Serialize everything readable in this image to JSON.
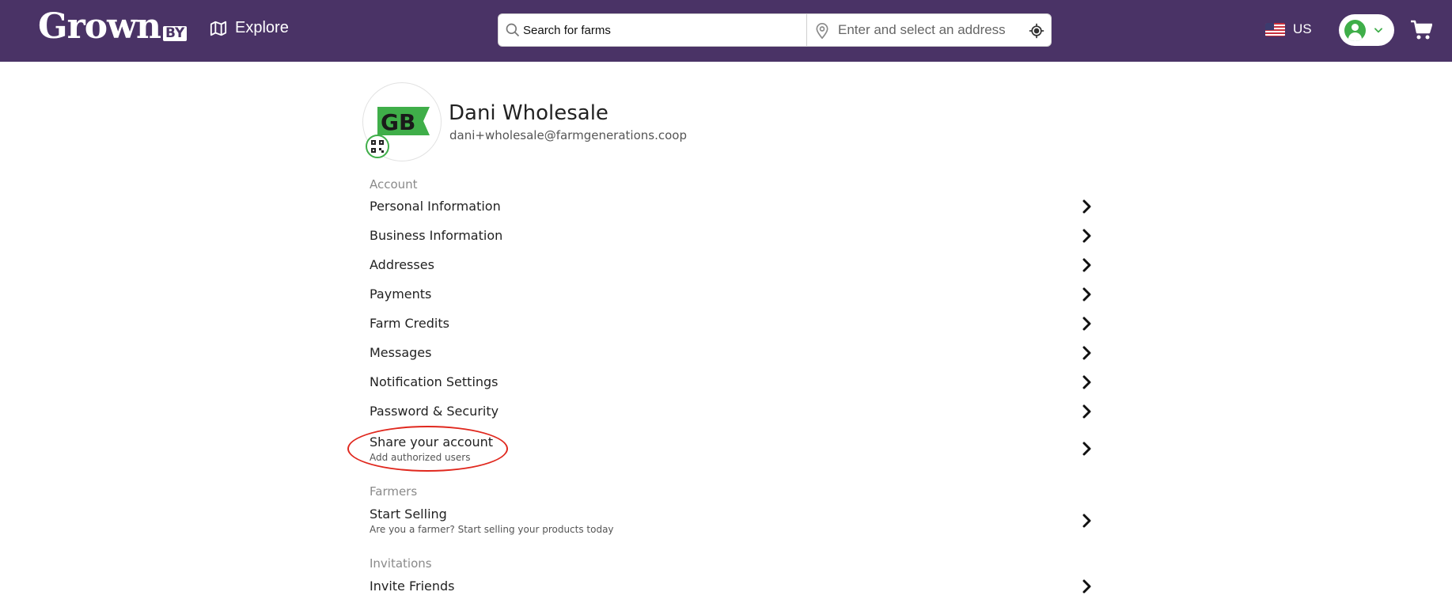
{
  "header": {
    "logo_main": "Grown",
    "logo_suffix": "BY",
    "explore_label": "Explore",
    "search_placeholder": "Search for farms",
    "address_placeholder": "Enter and select an address",
    "locale_label": "US",
    "icons": {
      "explore": "map-icon",
      "search": "search-icon",
      "address": "location-pin-icon",
      "locate": "crosshair-icon",
      "flag": "us-flag-icon",
      "user": "user-avatar-icon",
      "dropdown": "chevron-down-icon",
      "cart": "cart-icon"
    },
    "colors": {
      "bar": "#4a3366",
      "accent_green": "#3fae49"
    }
  },
  "profile": {
    "name": "Dani Wholesale",
    "email": "dani+wholesale@farmgenerations.coop",
    "avatar_logo": "GB"
  },
  "menu": {
    "sections": [
      {
        "title": "Account",
        "items": [
          {
            "label": "Personal Information"
          },
          {
            "label": "Business Information"
          },
          {
            "label": "Addresses"
          },
          {
            "label": "Payments"
          },
          {
            "label": "Farm Credits"
          },
          {
            "label": "Messages"
          },
          {
            "label": "Notification Settings"
          },
          {
            "label": "Password & Security"
          },
          {
            "label": "Share your account",
            "subtitle": "Add authorized users",
            "highlighted": true
          }
        ]
      },
      {
        "title": "Farmers",
        "items": [
          {
            "label": "Start Selling",
            "subtitle": "Are you a farmer? Start selling your products today"
          }
        ]
      },
      {
        "title": "Invitations",
        "items": [
          {
            "label": "Invite Friends"
          }
        ]
      }
    ]
  },
  "annotation": {
    "highlight_color": "#e0281e"
  }
}
